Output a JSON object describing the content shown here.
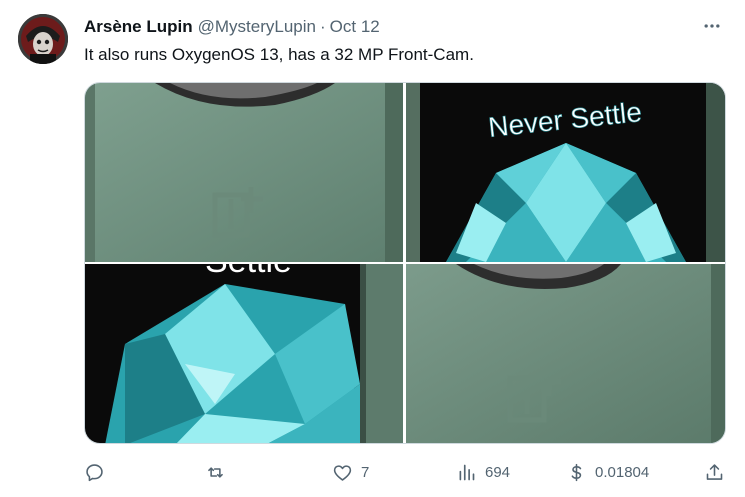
{
  "tweet": {
    "author_name": "Arsène Lupin",
    "handle": "@MysteryLupin",
    "separator": "·",
    "date": "Oct 12",
    "text": "It also runs OxygenOS 13, has a 32 MP Front-Cam.",
    "media_text": {
      "top_right_caption": "Never Settle",
      "bottom_left_caption": "Settle"
    }
  },
  "actions": {
    "replies": "",
    "retweets": "",
    "likes": "7",
    "views": "694",
    "tip": "0.01804"
  },
  "colors": {
    "phone_green": "#7d9b8a",
    "crystal_teal": "#3fbfc7",
    "text_secondary": "#536471",
    "text_primary": "#0f1419"
  },
  "icons": {
    "more": "more-icon",
    "reply": "reply-icon",
    "retweet": "retweet-icon",
    "like": "heart-icon",
    "views": "views-icon",
    "tip": "dollar-icon",
    "share": "share-icon"
  }
}
